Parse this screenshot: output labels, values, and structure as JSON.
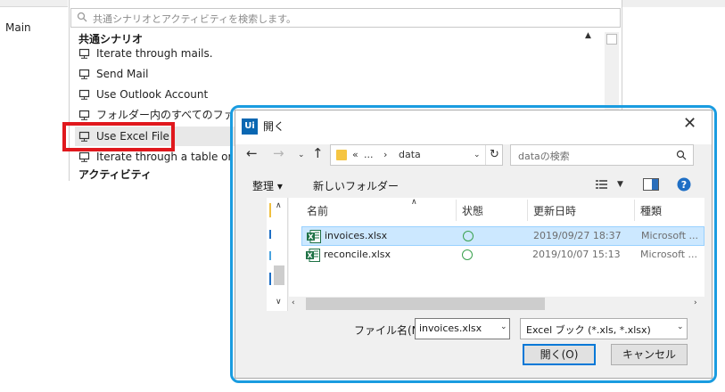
{
  "background_app": {
    "main_tab": "Main",
    "search_placeholder": "共通シナリオとアクティビティを検索します。",
    "category_label": "共通シナリオ",
    "items": [
      {
        "label": "Iterate through mails."
      },
      {
        "label": "Send Mail"
      },
      {
        "label": "Use Outlook Account"
      },
      {
        "label": "フォルダー内のすべてのファイルに"
      },
      {
        "label": "Use Excel File"
      },
      {
        "label": "Iterate through a table or rang"
      }
    ],
    "activities_label": "アクティビティ"
  },
  "dialog": {
    "title": "開く",
    "logo_text": "Ui",
    "close_glyph": "✕",
    "address": {
      "ellipsis": "«",
      "dots": "...",
      "folder": "data"
    },
    "search_placeholder": "dataの検索",
    "toolbar": {
      "organize": "整理 ▾",
      "new_folder": "新しいフォルダー"
    },
    "columns": [
      "名前",
      "状態",
      "更新日時",
      "種類"
    ],
    "files": [
      {
        "name": "invoices.xlsx",
        "modified": "2019/09/27 18:37",
        "type": "Microsoft ..."
      },
      {
        "name": "reconcile.xlsx",
        "modified": "2019/10/07 15:13",
        "type": "Microsoft ..."
      }
    ],
    "filename_label": "ファイル名(N):",
    "filename_value": "invoices.xlsx",
    "filter_value": "Excel ブック (*.xls, *.xlsx)",
    "open_button": "開く(O)",
    "cancel_button": "キャンセル"
  },
  "colors": {
    "highlight_box": "#e0181d",
    "dialog_outline": "#1a9ce0",
    "selection": "#cce8ff",
    "excel_green": "#1e7145"
  }
}
